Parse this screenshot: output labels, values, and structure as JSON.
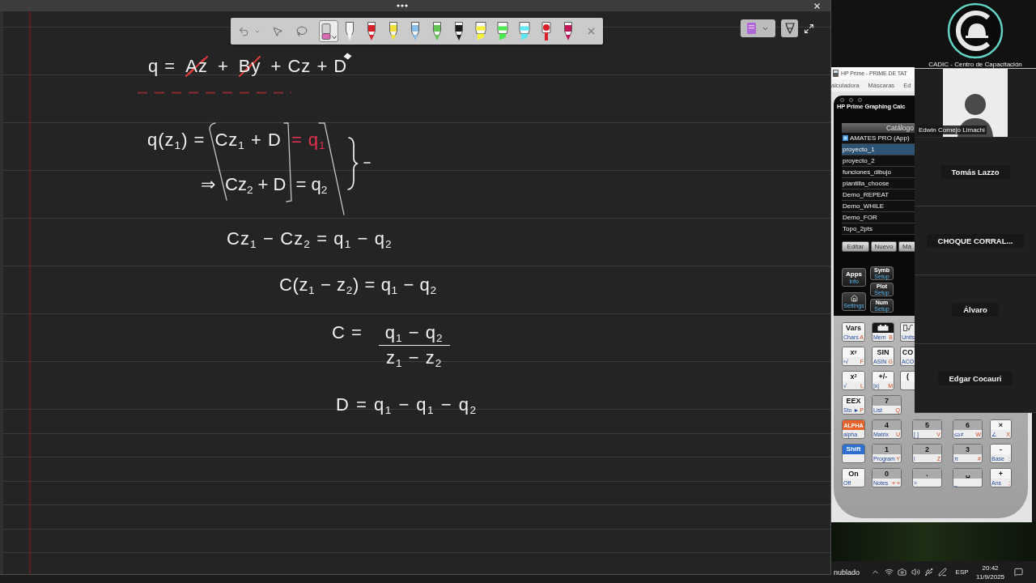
{
  "whiteboard": {
    "pen_toolbar": {
      "tools": [
        {
          "kind": "select",
          "selected": false
        },
        {
          "kind": "lasso",
          "selected": false
        },
        {
          "kind": "eraser",
          "selected": true
        },
        {
          "kind": "pen",
          "color": "#f4f4f4",
          "selected": false
        },
        {
          "kind": "pen",
          "color": "#d81f2a",
          "selected": false
        },
        {
          "kind": "pen",
          "color": "#f3df3b",
          "selected": false
        },
        {
          "kind": "pen",
          "color": "#86bde9",
          "selected": false
        },
        {
          "kind": "pen",
          "color": "#5fc452",
          "selected": false
        },
        {
          "kind": "pen",
          "color": "#1b1b1b",
          "selected": false
        },
        {
          "kind": "highlighter",
          "color": "#f6f23c",
          "selected": false
        },
        {
          "kind": "highlighter",
          "color": "#4be84f",
          "selected": false
        },
        {
          "kind": "highlighter",
          "color": "#5ee8f2",
          "selected": false
        },
        {
          "kind": "marker",
          "color": "#d81f2a",
          "selected": false
        },
        {
          "kind": "pen",
          "color": "#c2185b",
          "selected": false
        }
      ]
    },
    "equations": [
      {
        "kind": "line",
        "segments": [
          {
            "text": "q =",
            "color": "#f0f0f0",
            "struck": false
          },
          {
            "text": "Az",
            "color": "#f0f0f0",
            "struck": true
          },
          {
            "text": "+",
            "color": "#f0f0f0",
            "struck": false
          },
          {
            "text": "By",
            "color": "#f0f0f0",
            "struck": true
          },
          {
            "text": "+ Cz + D",
            "color": "#f0f0f0",
            "struck": false
          }
        ]
      },
      {
        "kind": "line",
        "segments": [
          {
            "text": "q(z$_{1}$) =",
            "color": "#f0f0f0",
            "struck": false
          },
          {
            "text": "Cz$_{1}$ + D",
            "color": "#f0f0f0",
            "struck": false
          },
          {
            "text": "= q$_{1}$",
            "color": "#e8314f",
            "struck": false
          }
        ]
      },
      {
        "kind": "line",
        "segments": [
          {
            "text": "⇒",
            "color": "#f0f0f0",
            "struck": false
          },
          {
            "text": "Cz$_{2}$ + D",
            "color": "#f0f0f0",
            "struck": false
          },
          {
            "text": "= q$_{2}$",
            "color": "#f0f0f0",
            "struck": false
          }
        ]
      },
      {
        "kind": "line",
        "segments": [
          {
            "text": "Cz$_{1}$ − Cz$_{2}$ = q$_{1}$ − q$_{2}$",
            "color": "#f0f0f0",
            "struck": false
          }
        ]
      },
      {
        "kind": "line",
        "segments": [
          {
            "text": "C(z$_{1}$ − z$_{2}$) = q$_{1}$ − q$_{2}$",
            "color": "#f0f0f0",
            "struck": false
          }
        ]
      },
      {
        "kind": "fraction",
        "lead": "C =",
        "numerator": "q$_{1}$ − q$_{2}$",
        "denominator": "z$_{1}$ − z$_{2}$"
      },
      {
        "kind": "line",
        "segments": [
          {
            "text": "D = q$_{1}$ − q$_{1}$ − q$_{2}$",
            "color": "#f0f0f0",
            "struck": false
          }
        ]
      }
    ]
  },
  "calculator": {
    "window_title": "HP Prime - PRIME DE TAT",
    "menu": [
      "alculadora",
      "Máscaras",
      "Ed"
    ],
    "screen_title": "HP Prime Graphing Calc",
    "catalog": {
      "header": "Catálogo",
      "items": [
        {
          "kind": "app",
          "label": "AMATES PRO (App)",
          "selected": false
        },
        {
          "kind": "program",
          "label": "proyecto_1",
          "selected": true
        },
        {
          "kind": "program",
          "label": "proyecto_2",
          "selected": false
        },
        {
          "kind": "program",
          "label": "funciones_dibujo",
          "selected": false
        },
        {
          "kind": "program",
          "label": "plantilla_choose",
          "selected": false
        },
        {
          "kind": "program",
          "label": "Demo_REPEAT",
          "selected": false
        },
        {
          "kind": "program",
          "label": "Demo_WHILE",
          "selected": false
        },
        {
          "kind": "program",
          "label": "Demo_FOR",
          "selected": false
        },
        {
          "kind": "program",
          "label": "Topo_2pts",
          "selected": false
        }
      ]
    },
    "soft_keys": [
      "Editar",
      "Nuevo",
      "Má"
    ],
    "app_keys": [
      {
        "kind": "text",
        "label": "Apps",
        "sub": "Info"
      },
      {
        "kind": "home",
        "sub": "Settings"
      },
      {
        "kind": "text",
        "label": "Symb",
        "sub": "Setup"
      },
      {
        "kind": "text",
        "label": "Plot",
        "sub": "Setup"
      },
      {
        "kind": "text",
        "label": "Num",
        "sub": "Setup"
      }
    ],
    "keys": [
      [
        {
          "kind": "function",
          "label": "Vars",
          "sub": "Chars",
          "alpha": "A"
        },
        {
          "kind": "mem",
          "sub": "Mem",
          "alpha": "B"
        },
        {
          "kind": "units",
          "sub": "Units"
        }
      ],
      [
        {
          "kind": "function",
          "label": "x$^{y}$",
          "sub": "ʸ√",
          "alpha": "F"
        },
        {
          "kind": "function",
          "label": "SIN",
          "sub": "ASIN",
          "alpha": "G"
        },
        {
          "kind": "function",
          "label": "CO",
          "sub": "ACO"
        }
      ],
      [
        {
          "kind": "function",
          "label": "x$^{2}$",
          "sub": "√",
          "alpha": "L"
        },
        {
          "kind": "function",
          "label": "+/-",
          "sub": "|x|",
          "alpha": "M"
        },
        {
          "kind": "function",
          "label": "("
        }
      ],
      [
        {
          "kind": "function",
          "label": "EEX",
          "sub": "Sto ►",
          "alpha": "P"
        },
        {
          "kind": "number",
          "label": "7",
          "sub": "List",
          "alpha": "Q"
        }
      ],
      [
        {
          "kind": "alpha",
          "label": "ALPHA",
          "sub": "alpha"
        },
        {
          "kind": "number",
          "label": "4",
          "sub": "Matrix",
          "alpha": "U"
        },
        {
          "kind": "number",
          "label": "5",
          "sub": "[ ]",
          "alpha": "V"
        },
        {
          "kind": "number",
          "label": "6",
          "sub": "≤≥≠",
          "alpha": "W"
        },
        {
          "kind": "function",
          "label": "×",
          "sub": "∠",
          "alpha": "X"
        }
      ],
      [
        {
          "kind": "shift",
          "label": "Shift"
        },
        {
          "kind": "number",
          "label": "1",
          "sub": "Program",
          "alpha": "Y"
        },
        {
          "kind": "number",
          "label": "2",
          "sub": "i",
          "alpha": "Z"
        },
        {
          "kind": "number",
          "label": "3",
          "sub": "π",
          "alpha": "#"
        },
        {
          "kind": "function",
          "label": "-",
          "sub": "Base",
          "alpha": ":"
        }
      ],
      [
        {
          "kind": "function",
          "label": "On",
          "sub": "Off"
        },
        {
          "kind": "number",
          "label": "0",
          "sub": "Notes",
          "alpha": "« »"
        },
        {
          "kind": "number",
          "label": ".",
          "sub": "="
        },
        {
          "kind": "number",
          "label": "␣",
          "sub": "_"
        },
        {
          "kind": "function",
          "label": "+",
          "sub": "Ans",
          "alpha": ";"
        }
      ]
    ]
  },
  "participants": [
    {
      "kind": "logo",
      "name": "CADIC - Centro de Capacitación"
    },
    {
      "kind": "avatar",
      "name": "Edwin Cornejo Limachi"
    },
    {
      "kind": "name",
      "name": "Tomás Lazzo"
    },
    {
      "kind": "name",
      "name": "CHOQUE CORRAL..."
    },
    {
      "kind": "name",
      "name": "Álvaro"
    },
    {
      "kind": "name",
      "name": "Edgar Cocauri"
    }
  ],
  "taskbar": {
    "weather": "nublado",
    "language": "ESP",
    "time": "20:42",
    "date": "11/9/2025"
  }
}
